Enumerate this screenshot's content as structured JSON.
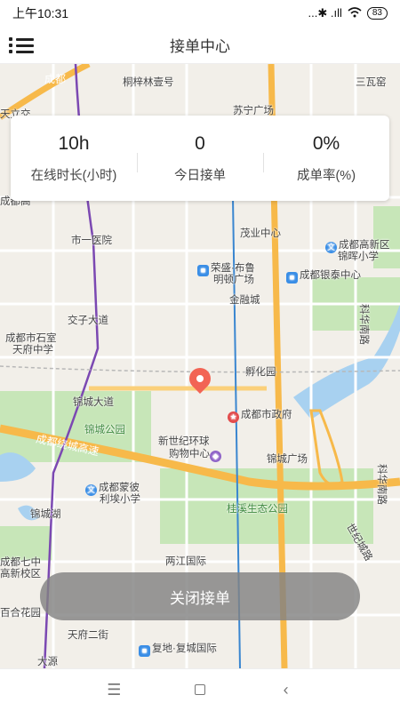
{
  "status_bar": {
    "time": "上午10:31",
    "signal_text": "...✱ .ıll",
    "battery": "83"
  },
  "header": {
    "title": "接单中心",
    "menu_icon": "menu-list-icon"
  },
  "stats": [
    {
      "value": "10h",
      "label": "在线时长(小时)"
    },
    {
      "value": "0",
      "label": "今日接单"
    },
    {
      "value": "0%",
      "label": "成单率(%)"
    }
  ],
  "map_labels": {
    "l1": "桐梓林壹号",
    "l2": "三瓦窑",
    "l3": "天立交",
    "l4": "苏宁广场",
    "l5": "成都",
    "l6": "茂业中心",
    "l7": "市一医院",
    "l8": "成都高新区",
    "l9": "锦晖小学",
    "l10": "荣盛·布鲁",
    "l11": "明顿广场",
    "l12": "成都银泰中心",
    "l13": "金融城",
    "l14": "交子大道",
    "l15": "成都市石室",
    "l16": "天府中学",
    "l17": "孵化园",
    "l18": "锦城大道",
    "l19": "成都市政府",
    "l20": "锦城公园",
    "l21": "新世纪环球",
    "l22": "购物中心",
    "l23": "锦城广场",
    "l24": "成都绕城高速",
    "l25": "成都蒙彼",
    "l26": "利埃小学",
    "l27": "锦城湖",
    "l28": "桂溪生态公园",
    "l29": "成都七中",
    "l30": "高新校区",
    "l31": "两江国际",
    "l32": "百合花园",
    "l33": "天府二街",
    "l34": "大源",
    "l35": "复地·复城国际",
    "l36": "科华南路",
    "l37": "世纪城路",
    "l38": "成都高",
    "l39": "科华南路"
  },
  "primary_action": {
    "label": "关闭接单"
  },
  "nav": {
    "menu": "☰",
    "home": "",
    "back": "‹"
  },
  "colors": {
    "map_bg": "#f2efe9",
    "road_major": "#f7b94a",
    "park": "#bfe3b0",
    "water": "#a8d1f0",
    "pin": "#f26454"
  }
}
